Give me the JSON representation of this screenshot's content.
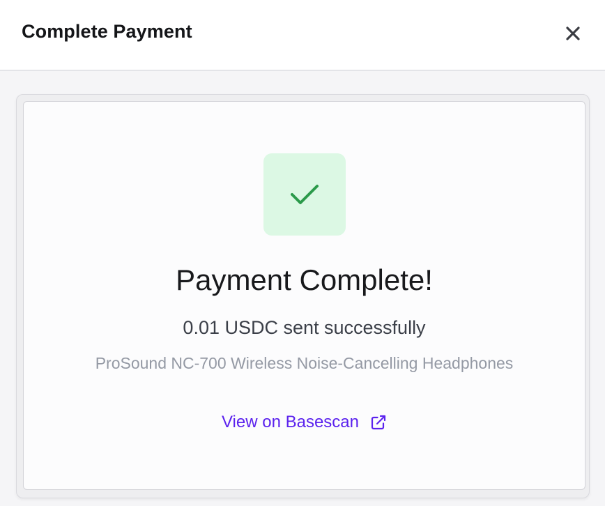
{
  "header": {
    "title": "Complete Payment",
    "close_icon": "close-icon"
  },
  "status": {
    "icon": "checkmark-icon",
    "headline": "Payment Complete!",
    "amount_text": "0.01 USDC sent successfully",
    "product_name": "ProSound NC-700 Wireless Noise-Cancelling Headphones"
  },
  "explorer_link": {
    "label": "View on Basescan",
    "icon": "external-link-icon"
  },
  "colors": {
    "accent": "#5b22ee",
    "success": "#2b9a4a",
    "success_bg": "#dcf8e4"
  }
}
